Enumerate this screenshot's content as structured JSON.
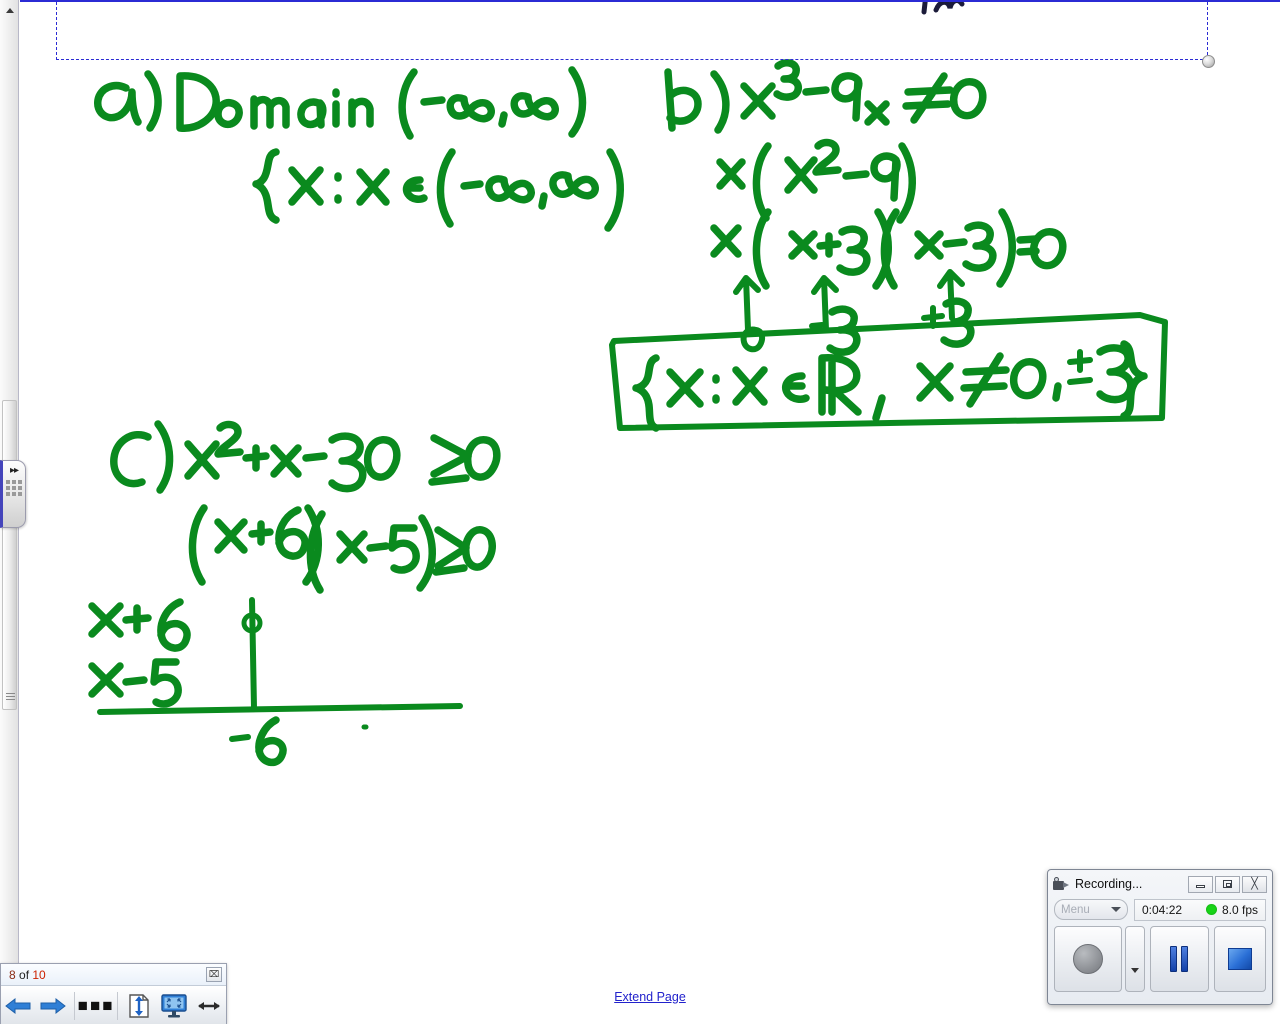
{
  "app": {
    "canvas_background": "#ffffff",
    "ink_color": "#0a8a1e",
    "selection_color": "#2b2bd4"
  },
  "canvas": {
    "extend_page_label": "Extend Page",
    "textbox_selection": {
      "name": "selected-text-object",
      "handle": "resize-handle"
    },
    "notes": [
      {
        "id": "part-a-line-1",
        "text": "a) Domain (-∞,∞)"
      },
      {
        "id": "part-a-line-2",
        "text": "{x : x ∈ (-∞,∞)"
      },
      {
        "id": "part-b-line-1",
        "text": "b) x³ - 9x ≠ 0"
      },
      {
        "id": "part-b-line-2",
        "text": "x (x² - 9)"
      },
      {
        "id": "part-b-line-3",
        "text": "x (x+3)(x-3) = 0"
      },
      {
        "id": "part-b-roots",
        "text": "0    -3    +3"
      },
      {
        "id": "part-b-answer-boxed",
        "text": "{x : x ∈ ℝ, x ≠ 0, ±3}"
      },
      {
        "id": "part-c-line-1",
        "text": "c) x² + x - 30 ≥ 0"
      },
      {
        "id": "part-c-line-2",
        "text": "(x+6)(x-5) ≥ 0"
      },
      {
        "id": "part-c-factor-1",
        "text": "x + 6"
      },
      {
        "id": "part-c-factor-2",
        "text": "x - 5"
      },
      {
        "id": "part-c-number-line-label",
        "text": "-6"
      }
    ]
  },
  "page_toolbar": {
    "page_counter_current": "8",
    "page_counter_middle": " of ",
    "page_counter_total": "10",
    "close_label": "⌧",
    "buttons": [
      {
        "name": "previous-page-button",
        "icon": "left-arrow-icon"
      },
      {
        "name": "next-page-button",
        "icon": "right-arrow-icon"
      },
      {
        "name": "more-options-button",
        "icon": "ellipsis-icon",
        "label": "..."
      },
      {
        "name": "fit-page-height-button",
        "icon": "page-fit-height-icon"
      },
      {
        "name": "fit-to-screen-button",
        "icon": "monitor-icon"
      },
      {
        "name": "fit-page-width-button",
        "icon": "horizontal-arrows-icon"
      }
    ]
  },
  "sidebar": {
    "expand_tab": {
      "name": "expand-sidebar-tab",
      "chevrons": "▸▸"
    },
    "scroll_up": "▲"
  },
  "recorder": {
    "title": "Recording...",
    "titlebar_buttons": [
      {
        "name": "minimize-button",
        "icon": "minimize-icon"
      },
      {
        "name": "restore-button",
        "icon": "restore-icon"
      },
      {
        "name": "close-button",
        "icon": "close-icon",
        "glyph": "⌧"
      }
    ],
    "menu_label": "Menu",
    "elapsed_time": "0:04:22",
    "frame_rate": "8.0 fps",
    "status_dot_color": "#17d417",
    "controls": [
      {
        "name": "record-button",
        "icon": "record-circle-icon"
      },
      {
        "name": "record-options-button",
        "icon": "caret-down-icon"
      },
      {
        "name": "pause-button",
        "icon": "pause-bars-icon"
      },
      {
        "name": "stop-button",
        "icon": "stop-square-icon"
      }
    ]
  }
}
